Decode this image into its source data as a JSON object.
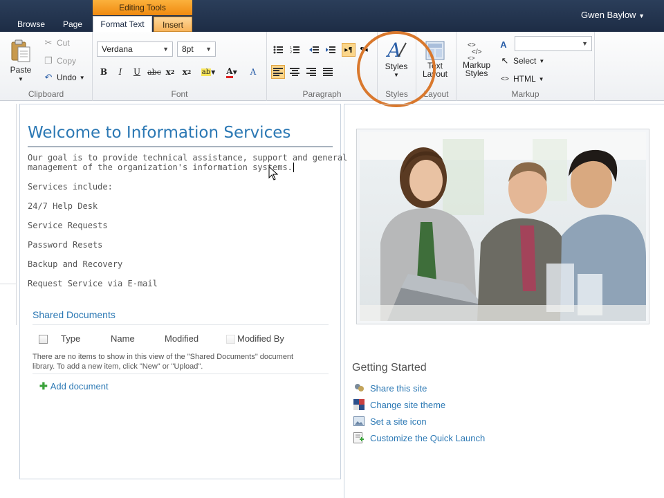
{
  "app": {
    "user": "Gwen Baylow"
  },
  "tabs": {
    "browse": "Browse",
    "page": "Page",
    "context_label": "Editing Tools",
    "format_text": "Format Text",
    "insert": "Insert"
  },
  "ribbon": {
    "clipboard": {
      "label": "Clipboard",
      "paste": "Paste",
      "cut": "Cut",
      "copy": "Copy",
      "undo": "Undo"
    },
    "font": {
      "label": "Font",
      "family": "Verdana",
      "size": "8pt"
    },
    "paragraph": {
      "label": "Paragraph"
    },
    "styles": {
      "label": "Styles",
      "styles_button": "Styles"
    },
    "layout": {
      "label": "Layout",
      "text_layout": "Text Layout"
    },
    "markup": {
      "label": "Markup",
      "markup_styles": "Markup Styles",
      "select": "Select",
      "html": "HTML"
    }
  },
  "content": {
    "title": "Welcome to Information Services",
    "intro_1": "Our goal is to provide technical assistance, support and general",
    "intro_2": "management of the organization's information systems.",
    "services_heading": "Services include:",
    "services": [
      "24/7 Help Desk",
      "Service Requests",
      "Password Resets",
      "Backup and Recovery",
      "Request Service via E-mail"
    ]
  },
  "shared_documents": {
    "title": "Shared Documents",
    "columns": [
      "Type",
      "Name",
      "Modified",
      "Modified By"
    ],
    "empty_1": "There are no items to show in this view of the \"Shared Documents\" document",
    "empty_2": "library. To add a new item, click \"New\" or \"Upload\".",
    "add": "Add document"
  },
  "getting_started": {
    "title": "Getting Started",
    "links": [
      "Share this site",
      "Change site theme",
      "Set a site icon",
      "Customize the Quick Launch"
    ]
  },
  "colors": {
    "accent": "#2b78b4",
    "context_tab": "#f5a024",
    "highlight_circle": "#d9782d",
    "topbar": "#22344f"
  }
}
